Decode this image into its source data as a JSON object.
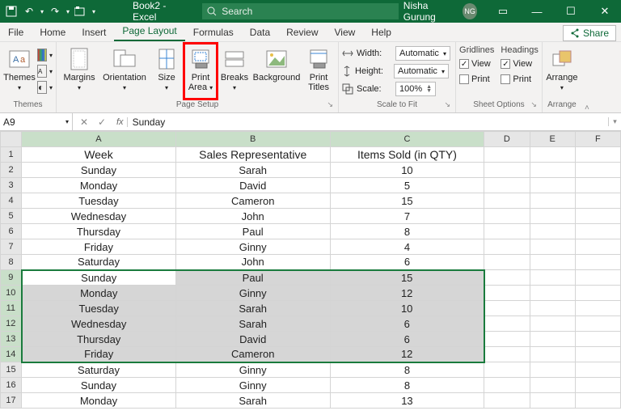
{
  "titlebar": {
    "filename": "Book2  -  Excel",
    "search_placeholder": "Search",
    "user_name": "Nisha Gurung",
    "user_initials": "NG"
  },
  "tabs": {
    "items": [
      "File",
      "Home",
      "Insert",
      "Page Layout",
      "Formulas",
      "Data",
      "Review",
      "View",
      "Help"
    ],
    "active": "Page Layout",
    "share": "Share"
  },
  "ribbon": {
    "themes": {
      "themes": "Themes",
      "label": "Themes"
    },
    "page_setup": {
      "margins": "Margins",
      "orientation": "Orientation",
      "size": "Size",
      "print_area": "Print\nArea",
      "breaks": "Breaks",
      "background": "Background",
      "print_titles": "Print\nTitles",
      "label": "Page Setup"
    },
    "scale": {
      "width_lbl": "Width:",
      "width_val": "Automatic",
      "height_lbl": "Height:",
      "height_val": "Automatic",
      "scale_lbl": "Scale:",
      "scale_val": "100%",
      "label": "Scale to Fit"
    },
    "sheet_options": {
      "gridlines": "Gridlines",
      "headings": "Headings",
      "view": "View",
      "print": "Print",
      "label": "Sheet Options"
    },
    "arrange": {
      "arrange": "Arrange",
      "label": "Arrange"
    }
  },
  "namebox": "A9",
  "formula": "Sunday",
  "columns": [
    "A",
    "B",
    "C",
    "D",
    "E",
    "F"
  ],
  "rows": [
    {
      "n": 1,
      "a": "Week",
      "b": "Sales Representative",
      "c": "Items Sold (in QTY)"
    },
    {
      "n": 2,
      "a": "Sunday",
      "b": "Sarah",
      "c": "10"
    },
    {
      "n": 3,
      "a": "Monday",
      "b": "David",
      "c": "5"
    },
    {
      "n": 4,
      "a": "Tuesday",
      "b": "Cameron",
      "c": "15"
    },
    {
      "n": 5,
      "a": "Wednesday",
      "b": "John",
      "c": "7"
    },
    {
      "n": 6,
      "a": "Thursday",
      "b": "Paul",
      "c": "8"
    },
    {
      "n": 7,
      "a": "Friday",
      "b": "Ginny",
      "c": "4"
    },
    {
      "n": 8,
      "a": "Saturday",
      "b": "John",
      "c": "6"
    },
    {
      "n": 9,
      "a": "Sunday",
      "b": "Paul",
      "c": "15"
    },
    {
      "n": 10,
      "a": "Monday",
      "b": "Ginny",
      "c": "12"
    },
    {
      "n": 11,
      "a": "Tuesday",
      "b": "Sarah",
      "c": "10"
    },
    {
      "n": 12,
      "a": "Wednesday",
      "b": "Sarah",
      "c": "6"
    },
    {
      "n": 13,
      "a": "Thursday",
      "b": "David",
      "c": "6"
    },
    {
      "n": 14,
      "a": "Friday",
      "b": "Cameron",
      "c": "12"
    },
    {
      "n": 15,
      "a": "Saturday",
      "b": "Ginny",
      "c": "8"
    },
    {
      "n": 16,
      "a": "Sunday",
      "b": "Ginny",
      "c": "8"
    },
    {
      "n": 17,
      "a": "Monday",
      "b": "Sarah",
      "c": "13"
    }
  ],
  "selection": {
    "startRow": 9,
    "endRow": 14,
    "cols": [
      "A",
      "B",
      "C"
    ],
    "activeCell": "A9"
  }
}
